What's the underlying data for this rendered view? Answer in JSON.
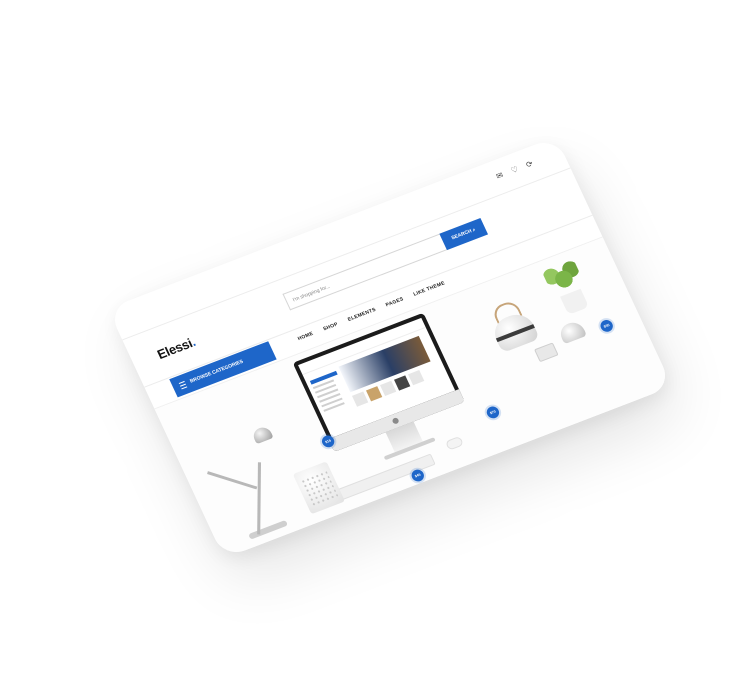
{
  "brand": {
    "logo_text": "Elessi",
    "logo_dot": ".",
    "accent": "#1e66c9"
  },
  "header": {
    "icons": [
      "mail-icon",
      "heart-icon",
      "refresh-icon"
    ],
    "search_placeholder": "I'm shopping for...",
    "search_label": "SEARCH"
  },
  "nav": {
    "browse_label": "BROWSE CATEGORIES",
    "links": [
      "HOME",
      "SHOP",
      "ELEMENTS",
      "PAGES",
      "LIKE THEME"
    ]
  },
  "hero": {
    "price_markers": [
      "$15",
      "$45",
      "$70",
      "$55"
    ]
  }
}
